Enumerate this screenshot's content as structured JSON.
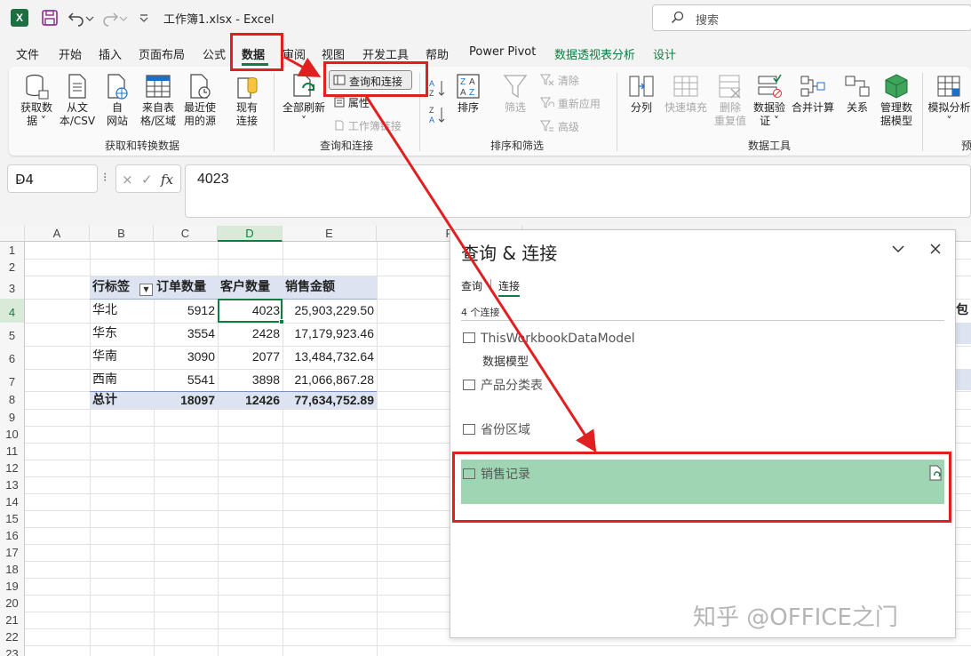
{
  "window": {
    "title": "工作簿1.xlsx  -  Excel",
    "app_logo": "X",
    "search_placeholder": "搜索"
  },
  "menu": [
    {
      "label": "文件"
    },
    {
      "label": "开始"
    },
    {
      "label": "插入"
    },
    {
      "label": "页面布局"
    },
    {
      "label": "公式"
    },
    {
      "label": "数据"
    },
    {
      "label": "审阅"
    },
    {
      "label": "视图"
    },
    {
      "label": "开发工具"
    },
    {
      "label": "帮助"
    },
    {
      "label": "Power Pivot"
    },
    {
      "label": "数据透视表分析"
    },
    {
      "label": "设计"
    }
  ],
  "ribbon": {
    "get_data": {
      "items": [
        {
          "label_l1": "获取数",
          "label_l2": "据 ˅"
        },
        {
          "label_l1": "从文",
          "label_l2": "本/CSV"
        },
        {
          "label_l1": "自",
          "label_l2": "网站"
        },
        {
          "label_l1": "来自表",
          "label_l2": "格/区域"
        },
        {
          "label_l1": "最近使",
          "label_l2": "用的源"
        },
        {
          "label_l1": "现有",
          "label_l2": "连接"
        }
      ],
      "group_label": "获取和转换数据"
    },
    "queries": {
      "refresh_all_l1": "全部刷新",
      "refresh_all_l2": "˅",
      "queries_connections": "查询和连接",
      "properties": "属性",
      "workbook_links": "工作簿链接",
      "group_label": "查询和连接"
    },
    "sort_filter": {
      "sort": "排序",
      "filter": "筛选",
      "clear": "清除",
      "reapply": "重新应用",
      "advanced": "高级",
      "group_label": "排序和筛选"
    },
    "data_tools": {
      "items": [
        {
          "label_l1": "分列",
          "label_l2": ""
        },
        {
          "label_l1": "快速填充",
          "label_l2": ""
        },
        {
          "label_l1": "删除",
          "label_l2": "重复值"
        },
        {
          "label_l1": "数据验",
          "label_l2": "证 ˅"
        },
        {
          "label_l1": "合并计算",
          "label_l2": ""
        },
        {
          "label_l1": "关系",
          "label_l2": ""
        },
        {
          "label_l1": "管理数",
          "label_l2": "据模型"
        }
      ],
      "group_label": "数据工具"
    },
    "forecast": {
      "whatif_l1": "模拟分析",
      "whatif_l2": "˅",
      "group_label": "预"
    }
  },
  "formula_bar": {
    "name_box": "D4",
    "fx": "fx",
    "cancel": "×",
    "enter": "✓",
    "value": "4023"
  },
  "sheet": {
    "columns": [
      "A",
      "B",
      "C",
      "D",
      "E",
      "F"
    ],
    "rows": [
      "1",
      "2",
      "3",
      "4",
      "5",
      "6",
      "7",
      "8",
      "9",
      "10",
      "11",
      "12",
      "13",
      "14",
      "15",
      "16",
      "17",
      "18",
      "19",
      "20",
      "21",
      "22",
      "23"
    ],
    "pivot_headers": [
      "行标签",
      "订单数量",
      "客户数量",
      "销售金额"
    ],
    "pivot_rows": [
      {
        "label": "华北",
        "orders": "5912",
        "customers": "4023",
        "sales": "25,903,229.50"
      },
      {
        "label": "华东",
        "orders": "3554",
        "customers": "2428",
        "sales": "17,179,923.46"
      },
      {
        "label": "华南",
        "orders": "3090",
        "customers": "2077",
        "sales": "13,484,732.64"
      },
      {
        "label": "西南",
        "orders": "5541",
        "customers": "3898",
        "sales": "21,066,867.28"
      }
    ],
    "pivot_total": {
      "label": "总计",
      "orders": "18097",
      "customers": "12426",
      "sales": "77,634,752.89"
    },
    "edge_cell": "包"
  },
  "pane": {
    "title": "查询 & 连接",
    "tabs": [
      "查询",
      "连接"
    ],
    "count_text": "4 个连接",
    "connections": [
      {
        "name": "ThisWorkbookDataModel",
        "sub": "数据模型"
      },
      {
        "name": "产品分类表",
        "sub": ""
      },
      {
        "name": "省份区域",
        "sub": ""
      },
      {
        "name": "销售记录",
        "sub": ""
      }
    ]
  },
  "watermark": "知乎 @OFFICE之门",
  "colors": {
    "excel_green": "#107c41",
    "annotation_red": "#e02020",
    "selection_fill": "#9fd5b3",
    "pivot_header_fill": "#dde3f1"
  }
}
